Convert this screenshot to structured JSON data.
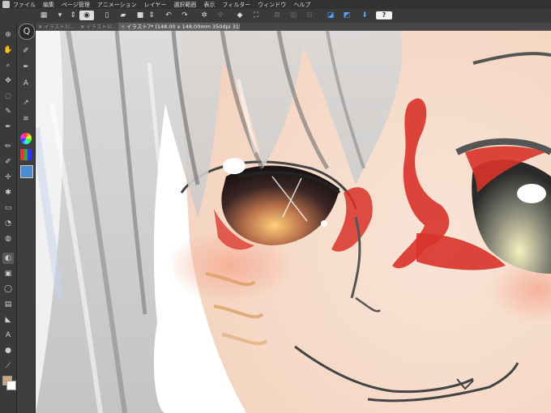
{
  "menubar": {
    "items": [
      "ファイル",
      "編集",
      "ページ管理",
      "アニメーション",
      "レイヤー",
      "選択範囲",
      "表示",
      "フィルター",
      "ウィンドウ",
      "ヘルプ"
    ]
  },
  "command_bar": {
    "icons": [
      "grid-icon",
      "arrow-dropdown-icon",
      "eye-icon",
      "new-file-icon",
      "open-folder-icon",
      "save-icon",
      "undo-icon",
      "redo-icon",
      "sparkle-icon",
      "transform-icon",
      "eraser-icon",
      "fill-icon",
      "crop-icon",
      "blend-icon",
      "clear-icon",
      "ruler-icon",
      "snap-icon",
      "download-icon"
    ],
    "help_label": "?"
  },
  "tabs": [
    {
      "label": "イラスト1(...",
      "active": false
    },
    {
      "label": "イラスト1(...",
      "active": false
    },
    {
      "label": "イラスト7* (148.00 x 148.00mm 350dpi 315.2%)",
      "active": true
    }
  ],
  "tools": [
    "zoom-icon",
    "hand-icon",
    "zoom-glass-icon",
    "move-icon",
    "lasso-icon",
    "eyedropper-icon",
    "pen-icon",
    "pencil-icon",
    "brush-icon",
    "airbrush-icon",
    "decoration-icon",
    "eraser-icon",
    "blend-icon",
    "fill-icon",
    "gradient-icon",
    "shape-icon",
    "frame-icon",
    "ruler-icon",
    "text-icon",
    "balloon-icon",
    "line-icon",
    "color-swatch-icon"
  ],
  "subtools": [
    "navigator-icon",
    "tool-property-icon",
    "brush-size-icon",
    "layer-property-icon",
    "layer-icon",
    "color-wheel-icon",
    "color-set-icon",
    "sub-view-icon"
  ],
  "colors": {
    "accent": "#5aa0ff",
    "main_color": "#c9a97a",
    "sub_color": "#ffffff"
  }
}
